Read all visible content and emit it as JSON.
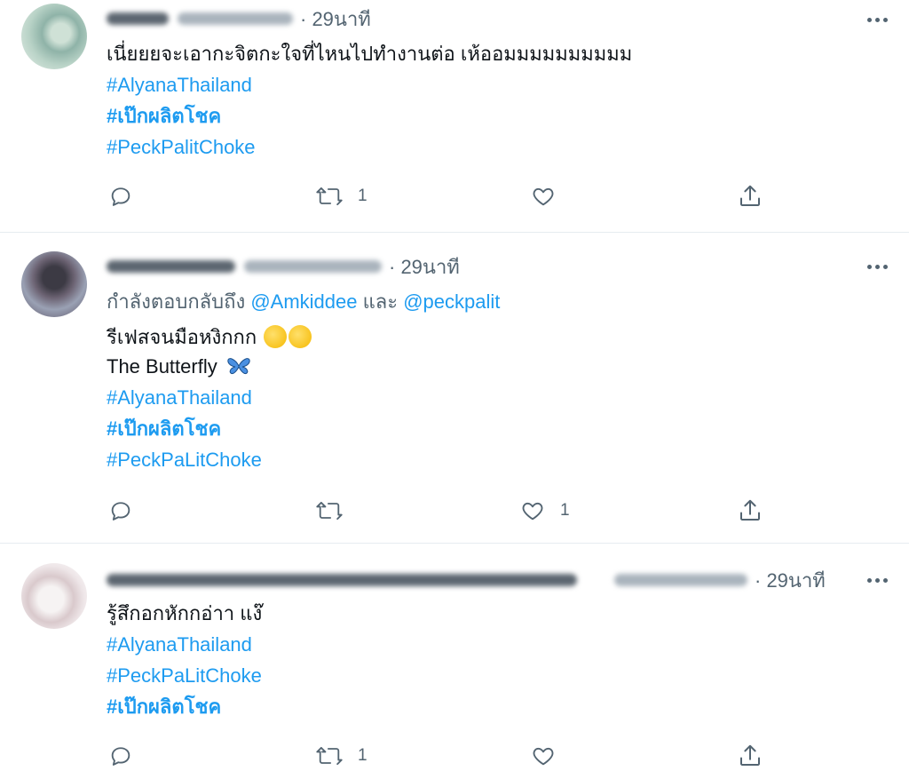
{
  "tweets": [
    {
      "time": "· 29นาที",
      "lines": [
        {
          "text": "เนี่ยยยจะเอากะจิตกะใจที่ไหนไปทำงานต่อ เห้ออมมมมมมมมมม",
          "kind": "text"
        },
        {
          "text": "#AlyanaThailand",
          "kind": "tag"
        },
        {
          "text": "#เป๊กผลิตโชค",
          "kind": "tag-bold"
        },
        {
          "text": "#PeckPalitChoke",
          "kind": "tag"
        }
      ],
      "reply_count": "",
      "retweet_count": "1",
      "like_count": ""
    },
    {
      "time": "· 29นาที",
      "reply_prefix": "กำลังตอบกลับถึง ",
      "reply_mention_1": "@Amkiddee",
      "reply_and": " และ ",
      "reply_mention_2": "@peckpalit",
      "lines": [
        {
          "text": "รีเฟสจนมือหงิกกก",
          "kind": "text"
        },
        {
          "text": "The Butterfly",
          "kind": "text"
        },
        {
          "text": "#AlyanaThailand",
          "kind": "tag"
        },
        {
          "text": "#เป๊กผลิตโชค",
          "kind": "tag-bold"
        },
        {
          "text": "#PeckPaLitChoke",
          "kind": "tag"
        }
      ],
      "reply_count": "",
      "retweet_count": "",
      "like_count": "1"
    },
    {
      "time": "· 29นาที",
      "lines": [
        {
          "text": "รู้สึกอกหักกอ่าา แง๊",
          "kind": "text"
        },
        {
          "text": "#AlyanaThailand",
          "kind": "tag"
        },
        {
          "text": "#PeckPaLitChoke",
          "kind": "tag"
        },
        {
          "text": "#เป๊กผลิตโชค",
          "kind": "tag-bold"
        }
      ],
      "reply_count": "",
      "retweet_count": "1",
      "like_count": ""
    }
  ],
  "icons": {
    "reply": "reply-icon",
    "retweet": "retweet-icon",
    "like": "heart-icon",
    "share": "share-icon",
    "more": "more-icon",
    "rofl_emoji": "rolling-on-floor-laughing-emoji",
    "grimace_emoji": "grimacing-face-emoji",
    "butterfly_emoji": "butterfly-emoji"
  },
  "colors": {
    "link": "#1d9bf0",
    "secondary": "#536471",
    "divider": "#e6ecf0"
  }
}
